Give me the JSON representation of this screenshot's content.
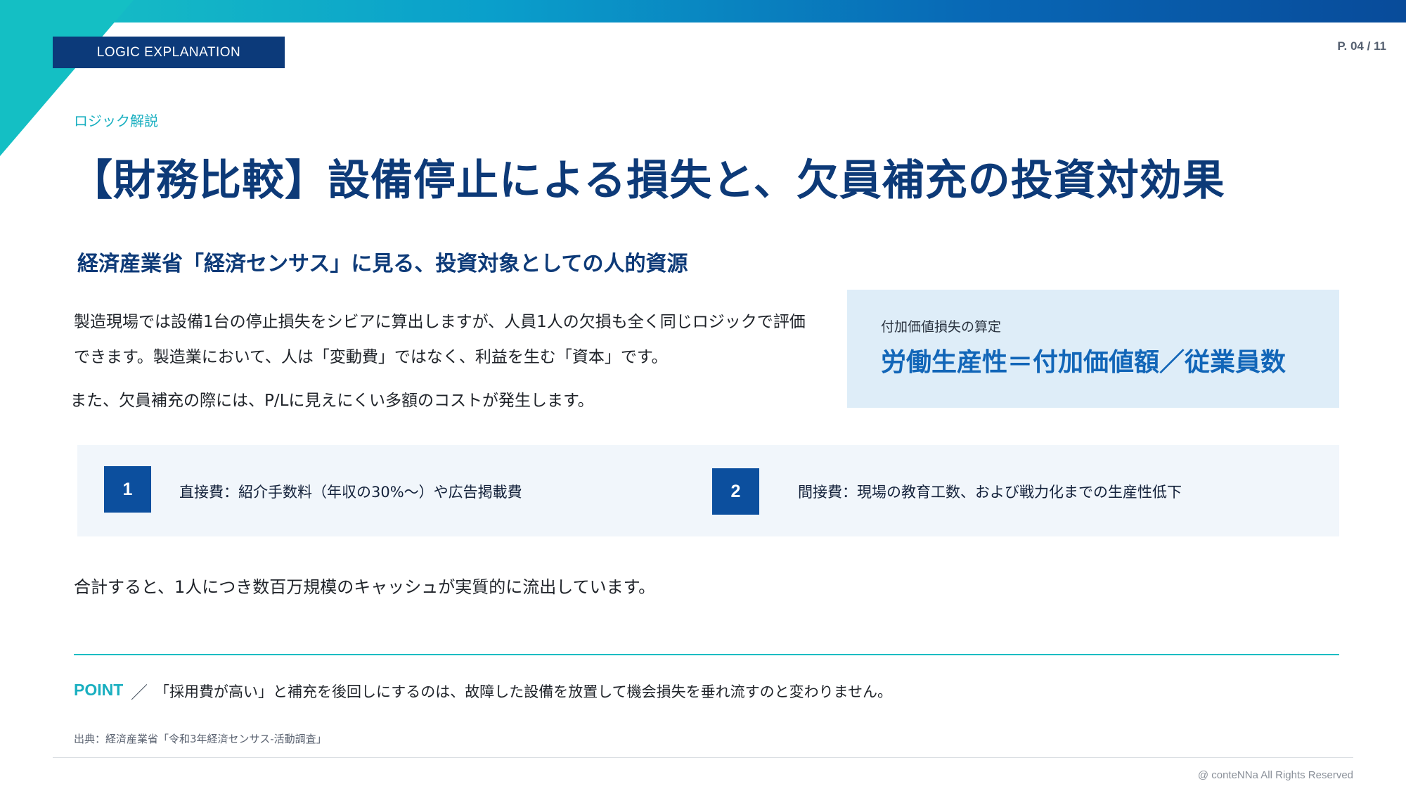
{
  "header": {
    "section_badge": "LOGIC EXPLANATION",
    "page_number": "P. 04 / 11",
    "eyebrow": "ロジック解説"
  },
  "title": "【財務比較】設備停止による損失と、欠員補充の投資対効果",
  "subheading": "経済産業省「経済センサス」に見る、投資対象としての人的資源",
  "body": {
    "paragraph1": "製造現場では設備1台の停止損失をシビアに算出しますが、人員1人の欠損も全く同じロジックで評価できます。製造業において、人は「変動費」ではなく、利益を生む「資本」です。",
    "paragraph2": "また、欠員補充の際には、P/Lに見えにくい多額のコストが発生します。"
  },
  "formula_box": {
    "label": "付加価値損失の算定",
    "formula": "労働生産性＝付加価値額／従業員数"
  },
  "costs": [
    {
      "number": "1",
      "text": "直接費：紹介手数料（年収の30%〜）や広告掲載費"
    },
    {
      "number": "2",
      "text": "間接費：現場の教育工数、および戦力化までの生産性低下"
    }
  ],
  "summary": "合計すると、1人につき数百万規模のキャッシュが実質的に流出しています。",
  "point": {
    "label": "POINT",
    "separator": "／",
    "text": "「採用費が高い」と補充を後回しにするのは、故障した設備を放置して機会損失を垂れ流すのと変わりません。"
  },
  "source": "出典：経済産業省「令和3年経済センサス‐活動調査」",
  "copyright": "@ conteNNa All Rights Reserved",
  "colors": {
    "navy": "#0c3a7a",
    "teal": "#19afc0",
    "blue": "#1266b8",
    "light_box": "#deedf8"
  }
}
